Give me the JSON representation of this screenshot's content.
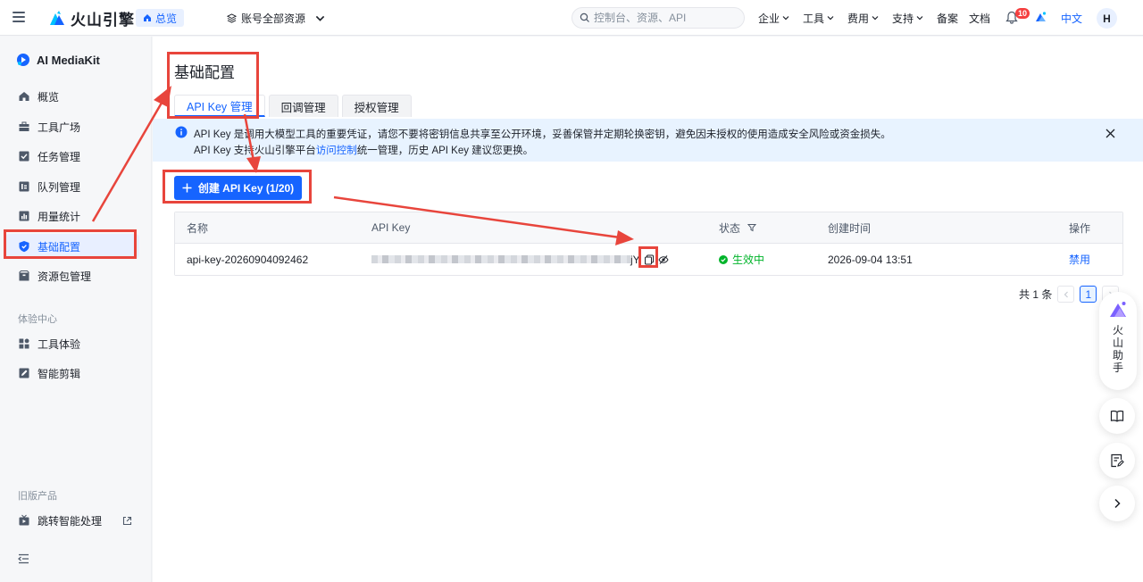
{
  "header": {
    "brand": "火山引擎",
    "home_label": "总览",
    "account_scope": "账号全部资源",
    "search_placeholder": "控制台、资源、API",
    "nav": [
      "企业",
      "工具",
      "费用",
      "支持",
      "备案",
      "文档"
    ],
    "notification_count": "10",
    "language": "中文",
    "avatar_initial": "H"
  },
  "sidebar": {
    "product_name": "AI MediaKit",
    "items": [
      {
        "label": "概览",
        "icon": "home-icon"
      },
      {
        "label": "工具广场",
        "icon": "toolbox-icon"
      },
      {
        "label": "任务管理",
        "icon": "task-icon"
      },
      {
        "label": "队列管理",
        "icon": "queue-icon"
      },
      {
        "label": "用量统计",
        "icon": "chart-icon"
      },
      {
        "label": "基础配置",
        "icon": "shield-icon"
      },
      {
        "label": "资源包管理",
        "icon": "package-icon"
      }
    ],
    "experience_section": "体验中心",
    "experience_items": [
      {
        "label": "工具体验",
        "icon": "grid-icon"
      },
      {
        "label": "智能剪辑",
        "icon": "edit-icon"
      }
    ],
    "legacy_section": "旧版产品",
    "legacy_items": [
      {
        "label": "跳转智能处理",
        "icon": "tv-icon"
      }
    ]
  },
  "main": {
    "title": "基础配置",
    "tabs": [
      "API Key 管理",
      "回调管理",
      "授权管理"
    ],
    "alert": {
      "line1": "API Key 是调用大模型工具的重要凭证，请您不要将密钥信息共享至公开环境，妥善保管并定期轮换密钥，避免因未授权的使用造成安全风险或资金损失。",
      "line2_prefix": "API Key 支持火山引擎平台",
      "line2_link": "访问控制",
      "line2_suffix": "统一管理，历史 API Key 建议您更换。"
    },
    "create_button": "创建 API Key (1/20)",
    "table": {
      "columns": [
        "名称",
        "API Key",
        "状态",
        "创建时间",
        "操作"
      ],
      "rows": [
        {
          "name": "api-key-20260904092462",
          "key_tail": "jY",
          "status": "生效中",
          "created": "2026-09-04 13:51",
          "action": "禁用"
        }
      ]
    },
    "pagination": {
      "total": "共 1 条",
      "current": "1"
    }
  },
  "assistant": {
    "label": "火山助手"
  },
  "colors": {
    "accent": "#1664ff",
    "success": "#00b42a",
    "annotation": "#e8453c"
  }
}
